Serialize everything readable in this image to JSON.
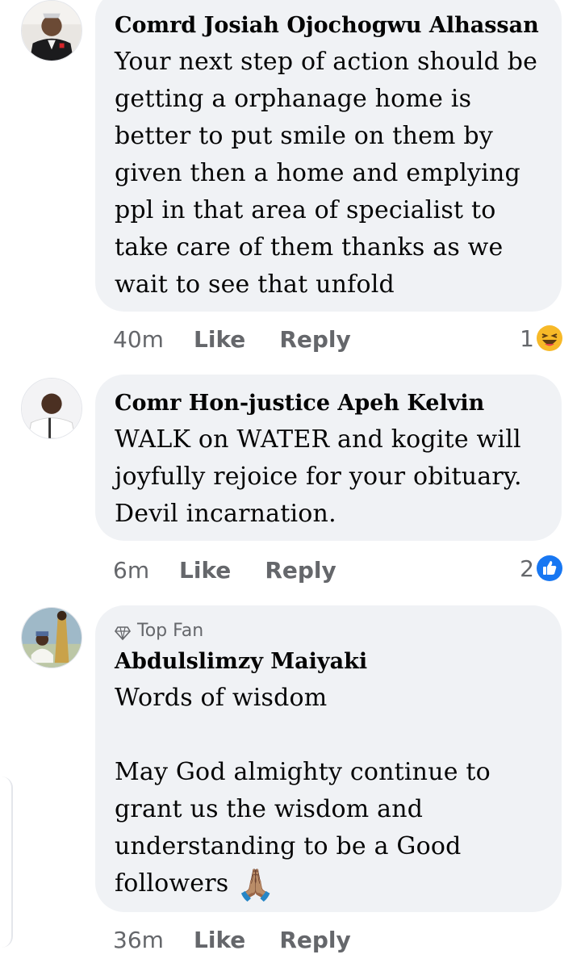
{
  "comments": [
    {
      "author": "Comrd Josiah Ojochogwu Alhassan",
      "text": "Your next step of action should be\ngetting a orphanage home is\nbetter to put smile on them by\ngiven then a home and emplying\nppl in that area of specialist to\ntake care of them thanks as we\nwait to see that unfold",
      "time": "40m",
      "like": "Like",
      "reply": "Reply",
      "reaction_count": "1",
      "reaction_icon": "laughing-emoji"
    },
    {
      "author": "Comr Hon-justice Apeh Kelvin",
      "text": "WALK on WATER and kogite will\njoyfully rejoice for your obituary.\nDevil incarnation.",
      "time": "6m",
      "like": "Like",
      "reply": "Reply",
      "reaction_count": "2",
      "reaction_icon": "like-thumb-icon"
    },
    {
      "badge": "Top Fan",
      "author": "Abdulslimzy Maiyaki",
      "text": "Words of wisdom\n\nMay God almighty continue to\ngrant us the wisdom and\nunderstanding to be a Good\nfollowers",
      "emoji": "🙏🏽",
      "time": "36m",
      "like": "Like",
      "reply": "Reply"
    }
  ],
  "colors": {
    "bubble": "#f0f2f5",
    "meta_text": "#65676b",
    "like_blue": "#1877f2",
    "laugh_yellow": "#f7b928"
  }
}
